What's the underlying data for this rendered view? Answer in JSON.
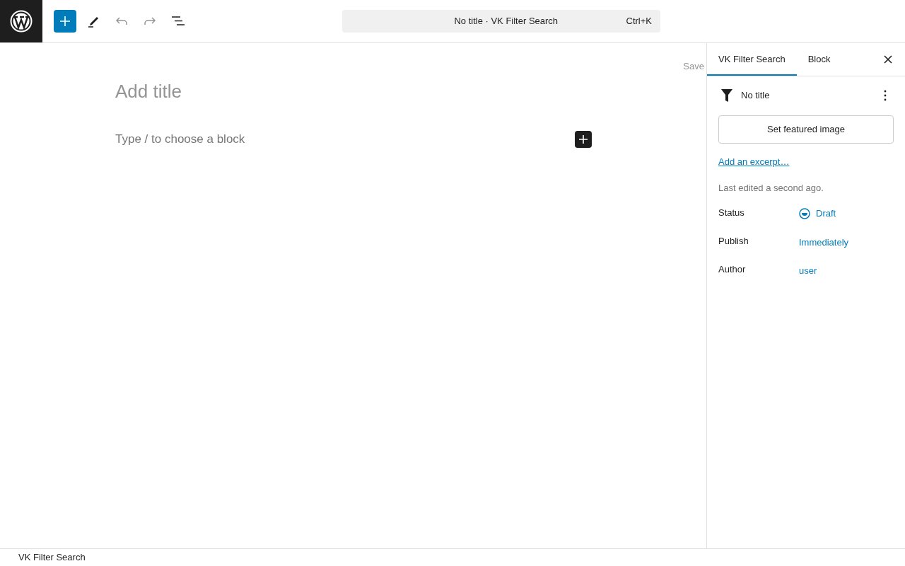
{
  "toolbar": {
    "undo": {
      "disabled": true
    },
    "redo": {
      "disabled": true
    },
    "command_bar": {
      "title": "No title · VK Filter Search",
      "shortcut": "Ctrl+K"
    }
  },
  "editor": {
    "save_label": "Save",
    "title_placeholder": "Add title",
    "block_placeholder": "Type / to choose a block"
  },
  "sidebar": {
    "tabs": [
      {
        "label": "VK Filter Search",
        "selected": true
      },
      {
        "label": "Block",
        "selected": false
      }
    ],
    "post_title": "No title",
    "featured_image_button": "Set featured image",
    "excerpt_link": "Add an excerpt…",
    "last_edited": "Last edited a second ago.",
    "fields": [
      {
        "label": "Status",
        "value": "Draft",
        "kind": "status"
      },
      {
        "label": "Publish",
        "value": "Immediately",
        "kind": "link"
      },
      {
        "label": "Author",
        "value": "user",
        "kind": "link"
      }
    ]
  },
  "footer": {
    "breadcrumb": "VK Filter Search"
  }
}
